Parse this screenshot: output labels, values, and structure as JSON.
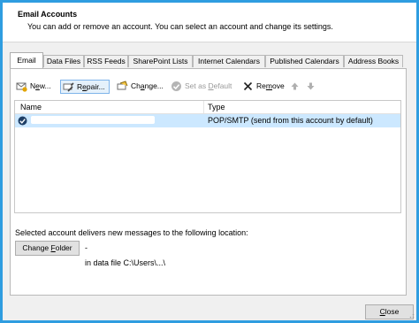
{
  "header": {
    "title": "Email Accounts",
    "subtitle": "You can add or remove an account. You can select an account and change its settings."
  },
  "tabs": [
    {
      "label": "Email"
    },
    {
      "label": "Data Files"
    },
    {
      "label": "RSS Feeds"
    },
    {
      "label": "SharePoint Lists"
    },
    {
      "label": "Internet Calendars"
    },
    {
      "label": "Published Calendars"
    },
    {
      "label": "Address Books"
    }
  ],
  "toolbar": {
    "new_pre": "N",
    "new_u": "e",
    "new_post": "w...",
    "repair_pre": "R",
    "repair_u": "e",
    "repair_post": "pair...",
    "change_pre": "Ch",
    "change_u": "a",
    "change_post": "nge...",
    "default_pre": "Set as ",
    "default_u": "D",
    "default_post": "efault",
    "remove_pre": "Re",
    "remove_u": "m",
    "remove_post": "ove"
  },
  "list": {
    "col_name": "Name",
    "col_type": "Type",
    "rows": [
      {
        "name": "",
        "type": "POP/SMTP (send from this account by default)"
      }
    ]
  },
  "delivery": {
    "label": "Selected account delivers new messages to the following location:",
    "folder_button_pre": "Change ",
    "folder_button_u": "F",
    "folder_button_post": "older",
    "folder_value": "-",
    "data_file": "in data file C:\\Users\\...\\"
  },
  "footer": {
    "close_pre": "",
    "close_u": "C",
    "close_post": "lose"
  },
  "colors": {
    "frame": "#2f9de0",
    "selection": "#cce8ff",
    "button_hover_border": "#7eb4ea"
  }
}
